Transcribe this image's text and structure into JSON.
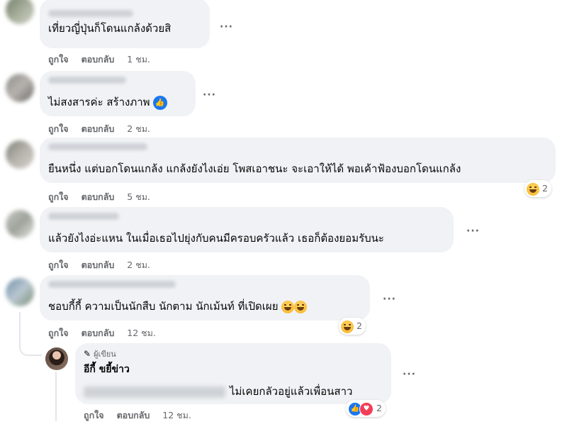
{
  "labels": {
    "like": "ถูกใจ",
    "reply": "ตอบกลับ",
    "more": "···"
  },
  "comments": [
    {
      "text": "เที่ยวญี่ปุ่นก็โดนแกล้งด้วยสิ",
      "time": "1 ชม."
    },
    {
      "text": "ไม่สงสารค่ะ สร้างภาพ",
      "time": "2 ชม.",
      "inline_icon": "like-icon"
    },
    {
      "text": "ยืนหนึ่ง แต่บอกโดนแกล้ง แกล้งยังไงเอ่ย โพสเอาชนะ จะเอาให้ได้ พอเค้าฟ้องบอกโดนแกล้ง",
      "time": "5 ชม.",
      "reaction_count": "2",
      "reaction_icon": "haha-icon"
    },
    {
      "text": "แล้วยังไงอ่ะแหน ในเมื่อเธอไปยุ่งกับคนมีครอบครัวแล้ว เธอก็ต้องยอมรับนะ",
      "time": "2 ชม."
    },
    {
      "text": "ชอบกี้กี้ ความเป็นนักสืบ นักตาม นักเม้นท์ ที่เปิดเผย",
      "time": "12 ชม.",
      "reaction_count": "2",
      "reaction_icon": "haha-icon"
    }
  ],
  "reply": {
    "badge": "ผู้เขียน",
    "name": "อีกี้ ขยี้ข่าว",
    "text": "ไม่เคยกลัวอยู่แล้วเพื่อนสาว",
    "time": "12 ชม.",
    "reaction_count": "2",
    "reaction_icons": [
      "like-icon",
      "love-icon"
    ]
  },
  "colors": {
    "bubble": "#f0f2f5",
    "meta": "#65676b",
    "like_blue": "#1877f2",
    "love_red": "#f33e58"
  }
}
